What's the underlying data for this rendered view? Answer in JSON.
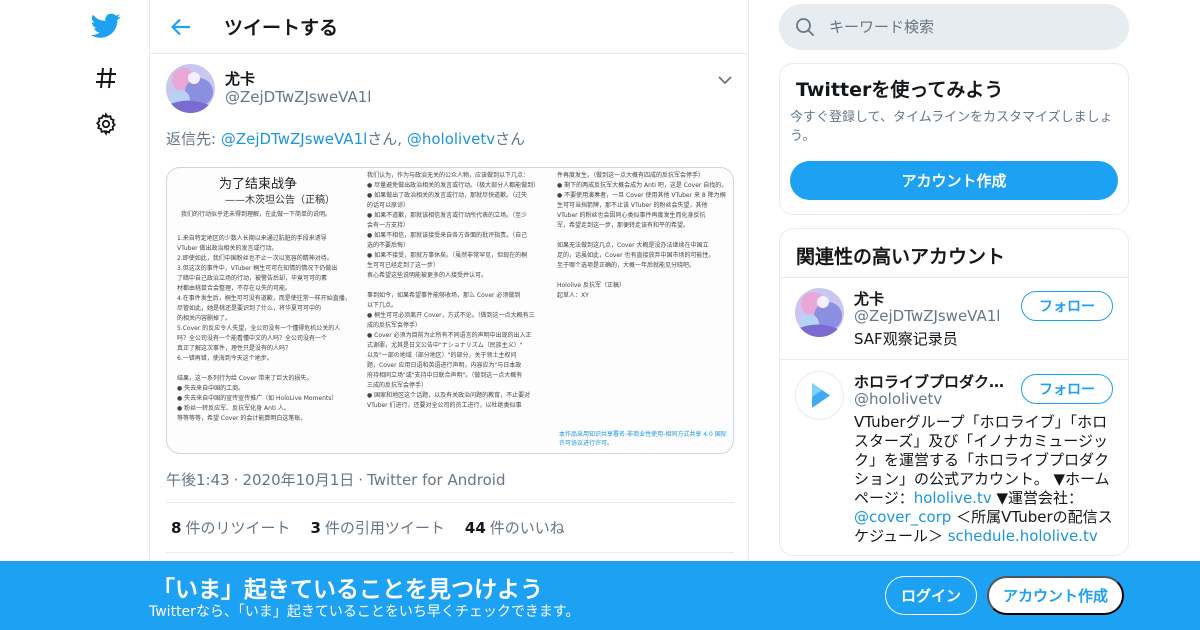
{
  "colors": {
    "accent": "#1da1f2",
    "link": "#1b95e0",
    "muted": "#657786",
    "text": "#14171a",
    "border": "#e6ecf0"
  },
  "nav": {
    "icons": [
      "twitter-bird-icon",
      "hashtag-icon",
      "gear-icon"
    ]
  },
  "header": {
    "title": "ツイートする"
  },
  "tweet": {
    "author_name": "尤卡",
    "author_handle": "@ZejDTwZJsweVA1l",
    "reply_prefix": "返信先: ",
    "reply_handle1": "@ZejDTwZJsweVA1l",
    "reply_suffix1": "さん, ",
    "reply_handle2": "@hololivetv",
    "reply_suffix2": "さん",
    "time": "午後1:43",
    "date": "2020年10月1日",
    "source": "Twitter for Android",
    "stats": {
      "retweets": "8",
      "retweets_label": "件のリツイート",
      "quotes": "3",
      "quotes_label": "件の引用ツイート",
      "likes": "44",
      "likes_label": "件のいいね"
    },
    "image": {
      "title": "为了结束战争",
      "subtitle": "——木茨坦公告（正稿）",
      "intro": "我们的行动似乎还未得到理解，在此做一下简单的说明。",
      "col1": [
        "1.来自特定地区的少数人长期以来通过肮脏的手段来诱导",
        "VTuber 做出政治相关的发言或行动。",
        "2.即使如此，我们中国粉丝也不止一次以宽容的精神对待。",
        "3.但这次的事件中，VTuber 桐生可可在知情的情况下仍做出",
        "了暗中自己政治立场的行动，被警告后却，毕竟可可的素",
        "材都由桃鼠合会整理，不存在以失的可能。",
        "4.在事件发生后，桐生可可没有道歉，而是使往常一样开始直播，",
        "尽管如此，她是桃还是要识到了什么，将华夏可可中的",
        "的相关内容删掉了。",
        "5.Cover 的反应令人失望，全公司没有一个懂得危机公关的人",
        "吗？全公司没有一个能看懂中文的人吗？全公司没有一个",
        "真正了解这次事件，理性只是没有的人吗？",
        "6.一错再错，使海到今天这个地步。",
        "",
        "结果，这一系列行为给 Cover 带来了巨大的损失。",
        "● 失去来自中国的工商。",
        "● 失去来自中国的宣传宣传推广（如 HoloLive Moments）",
        "● 粉丝一转反应军、反抗军化身 Anti 人。",
        "等等等等，希望 Cover 的会计能算明白这笔账。"
      ],
      "col2": [
        "我们认为，作为与政治无关的公众人物，应该做到以下几点：",
        "● 尽量避免做出政治相关的发言或行动。（极大部分人都能做到）",
        "● 如果做出了政治相关的发言或行动，那就尽快道歉。（过失",
        "的话可以原谅）",
        "● 如果不道歉，那就该相信发言或行动所代表的立场。（至少",
        "会有一方支持）",
        "● 如果不相信，那就该接受来自各方各面的批评指责。（自己",
        "选的不要后悔）",
        "● 如果不接受，那就万事休矣。（虽然非常罕见，但现在的桐",
        "生可可已经走到了这一步）",
        "衷心希望这些说明能被更多的人接受并认可。",
        "",
        "事到如今，如果希望事件能够收场，那么 Cover 必须做到",
        "以下几点。",
        "● 桐生可可必须离开 Cover，方式不论。（做到这一点大概有三",
        "成的反抗军会停手）",
        "● Cover 必须为目前为止所有不同语言的声明中出现的出入正",
        "式谢罪，尤其是日文公告中\"ナショナリズム（民族主义）\"",
        "以及\"一部の地域（部分地区）\"的部分，关于领土主权问",
        "题，Cover 应用日语和英语进行声明，内容应为\"与日本政",
        "府持相同立场\"或\"支持中日联合声明\"。（做到这一点大概有",
        "三成的反抗军会停手）",
        "● 国家和地区这个话题，以及有关政治问题的教育，不止要对",
        "VTuber 们进行，还要对全公司的员工进行，以杜绝类似事"
      ],
      "col3": [
        "件再度发生。（做到这一点大概有四成的反抗军会停手）",
        "● 剩下的两成反抗军大概会成为 Anti 吧，这是 Cover 自找的。",
        "● 不要使用演奏者，一旦 Cover 使用其他 VTuber 来 8 降为桐",
        "生可可当挡箭牌，那不止该 VTuber 的粉丝会失望，其他",
        "VTuber 的粉丝也会因同心类似事件再度发生而化身反抗",
        "军，希望走到这一步，那便转走该有和平的希望。",
        "",
        "如果无法做到这几点，Cover 大概是没办法继续在中国立",
        "足的，话虽如此，Cover 也有直接放弃中国市场的可能性。",
        "至于哪个选项是正确的，大概一年后就能见分晓吧。",
        "",
        "Hololive 反抗军（正稿）",
        "起草人：XY"
      ],
      "footer": "本作品采用知识共享署名-非商业性使用-相同方式共享 4.0 国际许可协议进行许可。"
    }
  },
  "search": {
    "placeholder": "キーワード検索"
  },
  "signup_card": {
    "title": "Twitterを使ってみよう",
    "desc": "今すぐ登録して、タイムラインをカスタマイズしましょう。",
    "button": "アカウント作成"
  },
  "related": {
    "title": "関連性の高いアカウント",
    "accounts": [
      {
        "name": "尤卡",
        "handle": "@ZejDTwZJsweVA1l",
        "bio": "SAF观察记录员",
        "follow": "フォロー"
      },
      {
        "name": "ホロライブプロダクション",
        "handle": "@hololivetv",
        "bio_part1": "VTuberグループ「ホロライブ」「ホロスターズ」及び「イノナカミュージック」を運営する「ホロライブプロダクション」の公式アカウント。 ▼ホームページ：",
        "bio_link1": "hololive.tv",
        "bio_part2": " ▼運営会社：",
        "bio_link2": "@cover_corp",
        "bio_part3": " ＜所属VTuberの配信スケジュール＞ ",
        "bio_link3": "schedule.hololive.tv",
        "follow": "フォロー"
      }
    ]
  },
  "banner": {
    "title": "「いま」起きていることを見つけよう",
    "subtitle": "Twitterなら、「いま」起きていることをいち早くチェックできます。",
    "login": "ログイン",
    "signup": "アカウント作成"
  }
}
